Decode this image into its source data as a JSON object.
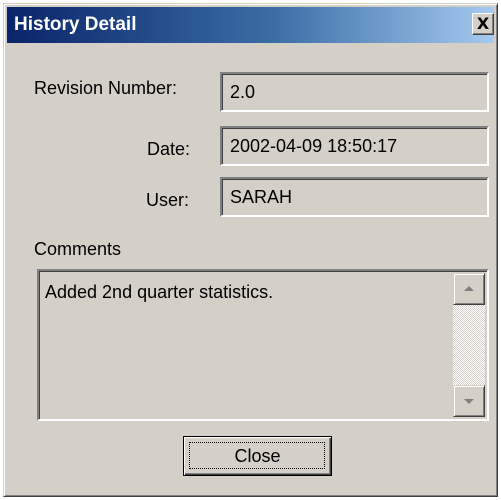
{
  "window": {
    "title": "History Detail",
    "close_glyph": "X",
    "title_gradient_start": "#0a246a",
    "title_gradient_end": "#a6caf0",
    "face_color": "#d4d0c8"
  },
  "fields": {
    "revision": {
      "label": "Revision Number:",
      "value": "2.0"
    },
    "date": {
      "label": "Date:",
      "value": "2002-04-09 18:50:17"
    },
    "user": {
      "label": "User:",
      "value": "SARAH"
    }
  },
  "comments": {
    "label": "Comments",
    "text": "Added 2nd quarter statistics."
  },
  "buttons": {
    "close_label": "Close"
  },
  "icons": {
    "window_close": "close-icon",
    "scroll_up": "scroll-up-arrow-icon",
    "scroll_down": "scroll-down-arrow-icon"
  }
}
